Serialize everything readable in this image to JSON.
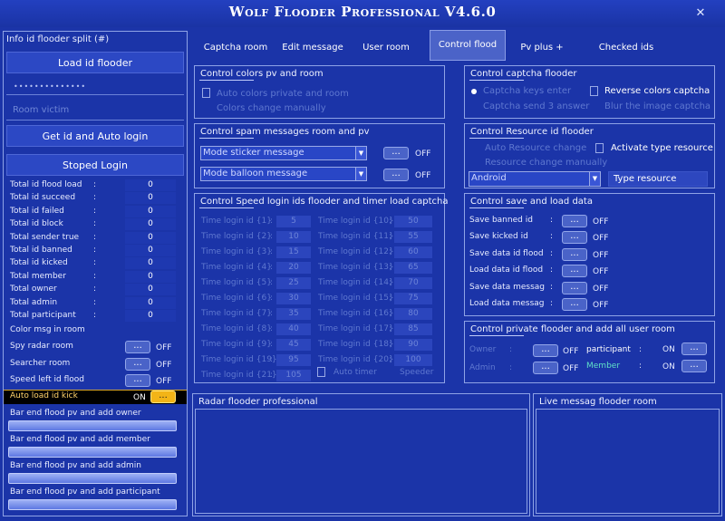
{
  "app": {
    "title": "Wolf Flooder Professional V4.6.0",
    "close_glyph": "✕"
  },
  "sidebar": {
    "title": "Info id flooder split (#)",
    "load_button": "Load id flooder",
    "password_mask": "••••••••••••••",
    "room_placeholder": "Room victim",
    "get_id_button": "Get id and Auto login",
    "stop_button": "Stoped Login",
    "stats": [
      {
        "label": "Total id flood load",
        "value": "0"
      },
      {
        "label": "Total id succeed",
        "value": "0"
      },
      {
        "label": "Total id failed",
        "value": "0"
      },
      {
        "label": "Total id block",
        "value": "0"
      },
      {
        "label": "Total sender true",
        "value": "0"
      },
      {
        "label": "Total id banned",
        "value": "0"
      },
      {
        "label": "Total id kicked",
        "value": "0"
      },
      {
        "label": "Total  member",
        "value": "0"
      },
      {
        "label": "Total  owner",
        "value": "0"
      },
      {
        "label": "Total  admin",
        "value": "0"
      },
      {
        "label": "Total  participant",
        "value": "0"
      }
    ],
    "colon": ":",
    "color_msg": "Color msg in room",
    "toggles": [
      {
        "label": "Spy radar room",
        "state": "OFF"
      },
      {
        "label": "Searcher room",
        "state": "OFF"
      },
      {
        "label": "Speed left id flood",
        "state": "OFF"
      }
    ],
    "auto_kick": {
      "label": "Auto load id kick",
      "state": "ON"
    },
    "bars": [
      "Bar end flood  pv and add owner",
      "Bar end flood  pv and add member",
      "Bar end flood  pv and add admin",
      "Bar end flood  pv and add participant"
    ]
  },
  "tabs": [
    "Captcha room",
    "Edit message",
    "User room",
    "Control flood",
    "Pv plus +",
    "Checked ids"
  ],
  "dots": "...",
  "colors_panel": {
    "title": "Control colors pv and room",
    "auto_colors": "Auto colors private and room",
    "colors_change": "Colors change manually"
  },
  "spam_panel": {
    "title": "Control spam messages room and pv",
    "sticker": "Mode sticker message",
    "balloon": "Mode balloon message",
    "state": "OFF"
  },
  "speed_panel": {
    "title": "Control Speed login ids flooder and timer load captcha",
    "left": [
      {
        "label": "Time login id {1}",
        "value": "5"
      },
      {
        "label": "Time login id {2}",
        "value": "10"
      },
      {
        "label": "Time login id {3}",
        "value": "15"
      },
      {
        "label": "Time login id {4}",
        "value": "20"
      },
      {
        "label": "Time login id {5}",
        "value": "25"
      },
      {
        "label": "Time login id {6}",
        "value": "30"
      },
      {
        "label": "Time login id {7}",
        "value": "35"
      },
      {
        "label": "Time login id {8}",
        "value": "40"
      },
      {
        "label": "Time login id {9}",
        "value": "45"
      },
      {
        "label": "Time login id {19}",
        "value": "95"
      },
      {
        "label": "Time login id {21}",
        "value": "105"
      }
    ],
    "right": [
      {
        "label": "Time login id {10}",
        "value": "50"
      },
      {
        "label": "Time login id {11}",
        "value": "55"
      },
      {
        "label": "Time login id {12}",
        "value": "60"
      },
      {
        "label": "Time login id {13}",
        "value": "65"
      },
      {
        "label": "Time login id {14}",
        "value": "70"
      },
      {
        "label": "Time login id {15}",
        "value": "75"
      },
      {
        "label": "Time login id {16}",
        "value": "80"
      },
      {
        "label": "Time login id {17}",
        "value": "85"
      },
      {
        "label": "Time login id {18}",
        "value": "90"
      },
      {
        "label": "Time login id {20}",
        "value": "100"
      }
    ],
    "auto_timer": "Auto timer",
    "speeder": "Speeder"
  },
  "captcha_panel": {
    "title": "Control captcha flooder",
    "keys_enter": "Captcha keys enter",
    "reverse": "Reverse colors captcha",
    "send3": "Captcha send 3 answer",
    "blur": "Blur the image captcha"
  },
  "resource_panel": {
    "title": "Control Resource id flooder",
    "auto_change": "Auto Resource change",
    "activate": "Activate type resource",
    "manual": "Resource change manually",
    "select_value": "Android",
    "type_label": "Type resource"
  },
  "save_panel": {
    "title": "Control save and load data",
    "items": [
      {
        "label": "Save banned id",
        "state": "OFF"
      },
      {
        "label": "Save kicked id",
        "state": "OFF"
      },
      {
        "label": "Save data id flood",
        "state": "OFF"
      },
      {
        "label": "Load data id flood",
        "state": "OFF"
      },
      {
        "label": "Save data messag",
        "state": "OFF"
      },
      {
        "label": "Load data messag",
        "state": "OFF"
      }
    ]
  },
  "private_panel": {
    "title": "Control private flooder and add  all user room",
    "owner": "Owner",
    "admin": "Admin",
    "participant": "participant",
    "member": "Member",
    "off": "OFF",
    "on": "ON"
  },
  "radar_panel": {
    "title": "Radar flooder professional"
  },
  "live_panel": {
    "title": "Live messag flooder room"
  },
  "colors": {
    "background": "#1b34a8",
    "active_toggle": "#f3b417",
    "member_text": "#5fe0c8"
  }
}
